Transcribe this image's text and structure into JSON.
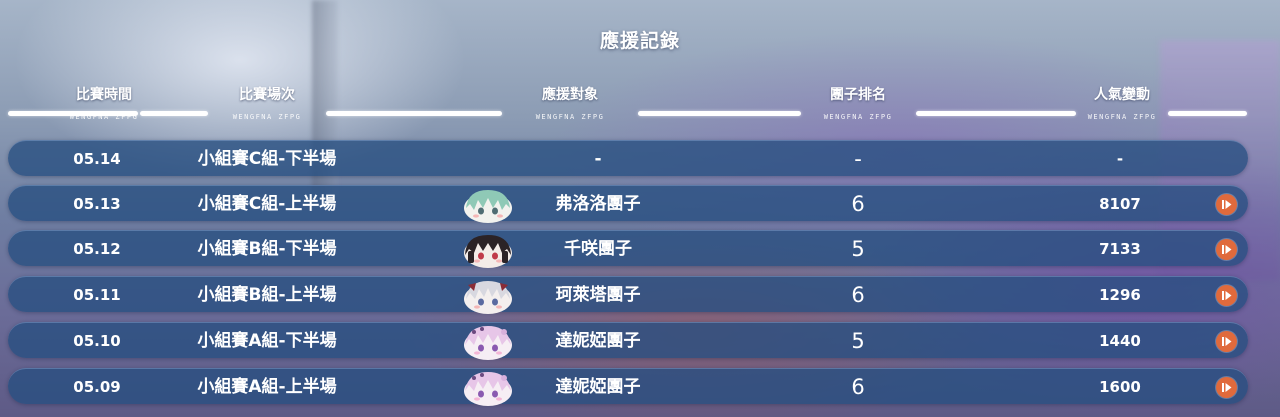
{
  "title": "應援記錄",
  "headers": [
    {
      "label": "比賽時間",
      "sub": "WENGFNA ZFPG"
    },
    {
      "label": "比賽場次",
      "sub": "WENGFNA ZFPG"
    },
    {
      "label": "應援對象",
      "sub": "WENGFNA ZFPG"
    },
    {
      "label": "團子排名",
      "sub": "WENGFNA ZFPG"
    },
    {
      "label": "人氣變動",
      "sub": "WENGFNA ZFPG"
    }
  ],
  "rows": [
    {
      "date": "05.14",
      "match": "小組賽C組-下半場",
      "target": "-",
      "rank": "-",
      "popularity": "-",
      "avatar": null
    },
    {
      "date": "05.13",
      "match": "小組賽C組-上半場",
      "target": "弗洛洛團子",
      "rank": "6",
      "popularity": "8107",
      "avatar": "frolo-dango-icon"
    },
    {
      "date": "05.12",
      "match": "小組賽B組-下半場",
      "target": "千咲團子",
      "rank": "5",
      "popularity": "7133",
      "avatar": "chisaki-dango-icon"
    },
    {
      "date": "05.11",
      "match": "小組賽B組-上半場",
      "target": "珂萊塔團子",
      "rank": "6",
      "popularity": "1296",
      "avatar": "carlotta-dango-icon"
    },
    {
      "date": "05.10",
      "match": "小組賽A組-下半場",
      "target": "達妮婭團子",
      "rank": "5",
      "popularity": "1440",
      "avatar": "dania-dango-icon"
    },
    {
      "date": "05.09",
      "match": "小組賽A組-上半場",
      "target": "達妮婭團子",
      "rank": "6",
      "popularity": "1600",
      "avatar": "dania-dango-icon"
    }
  ],
  "colors": {
    "row_bg": "#264e80",
    "play_button": "#e06a3c",
    "text": "#ffffff"
  }
}
